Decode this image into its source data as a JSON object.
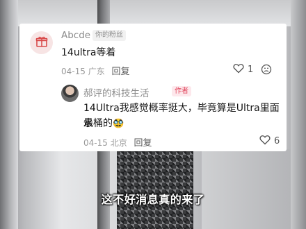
{
  "comment": {
    "username": "Abcde",
    "fan_tag": "你的粉丝",
    "text": "14ultra等着",
    "date": "04-15",
    "location": "广东",
    "reply_label": "回复",
    "like_count": "1"
  },
  "reply": {
    "author": "郝评的科技生活",
    "author_tag": "作者",
    "text_line1": "14Ultra我感觉概率挺大，毕竟算是Ultra里面最",
    "text_line2": "水桶的",
    "emoji": "🥸",
    "date": "04-15",
    "location": "北京",
    "reply_label": "回复",
    "like_count": "6"
  },
  "subtitle": "这不好消息真的来了",
  "colors": {
    "author_tag": "#e0455b",
    "gift_avatar_bg": "#f7e4e4"
  },
  "icons": [
    "gift-icon",
    "heart-icon",
    "dislike-icon"
  ]
}
